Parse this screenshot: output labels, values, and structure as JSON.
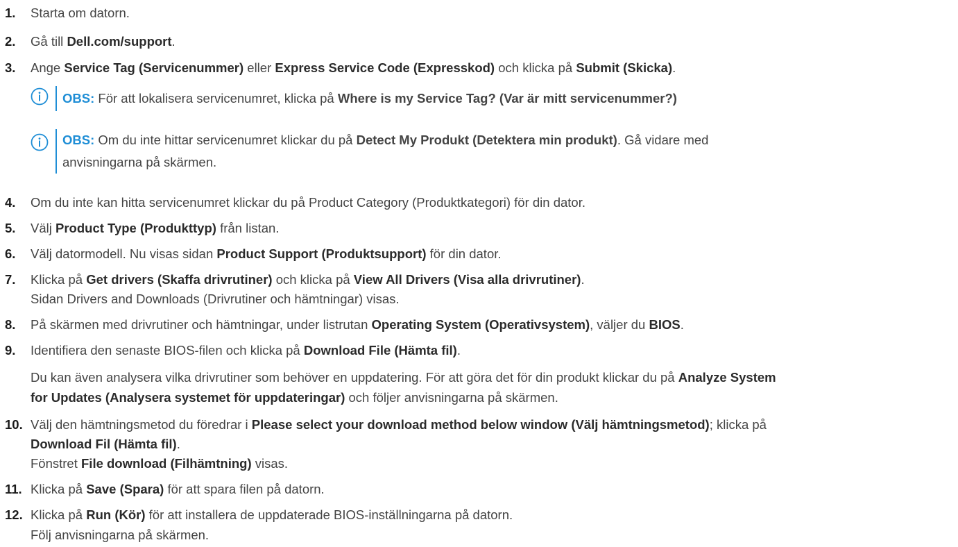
{
  "steps": [
    {
      "num": "1.",
      "parts": [
        {
          "t": "Starta om datorn."
        }
      ]
    },
    {
      "num": "2.",
      "parts": [
        {
          "t": "Gå till "
        },
        {
          "b": "Dell.com/support"
        },
        {
          "t": "."
        }
      ]
    },
    {
      "num": "3.",
      "parts": [
        {
          "t": "Ange "
        },
        {
          "b": "Service Tag (Servicenummer)"
        },
        {
          "t": " eller "
        },
        {
          "b": "Express Service Code (Expresskod)"
        },
        {
          "t": " och klicka på "
        },
        {
          "b": "Submit (Skicka)"
        },
        {
          "t": "."
        }
      ]
    },
    {
      "num": "4.",
      "parts": [
        {
          "t": "Om du inte kan hitta servicenumret klickar du på Product Category (Produktkategori) för din dator."
        }
      ]
    },
    {
      "num": "5.",
      "parts": [
        {
          "t": "Välj "
        },
        {
          "b": "Product Type (Produkttyp)"
        },
        {
          "t": " från listan."
        }
      ]
    },
    {
      "num": "6.",
      "parts": [
        {
          "t": "Välj datormodell. Nu visas sidan "
        },
        {
          "b": "Product Support (Produktsupport)"
        },
        {
          "t": " för din dator."
        }
      ]
    },
    {
      "num": "7.",
      "parts": [
        {
          "t": "Klicka på "
        },
        {
          "b": "Get drivers (Skaffa drivrutiner)"
        },
        {
          "t": " och klicka på "
        },
        {
          "b": "View All Drivers (Visa alla drivrutiner)"
        },
        {
          "t": "."
        }
      ]
    },
    {
      "num": "8.",
      "parts": [
        {
          "t": "På skärmen med drivrutiner och hämtningar, under listrutan "
        },
        {
          "b": "Operating System (Operativsystem)"
        },
        {
          "t": ", väljer du "
        },
        {
          "b": "BIOS"
        },
        {
          "t": "."
        }
      ]
    },
    {
      "num": "9.",
      "parts": [
        {
          "t": "Identifiera den senaste BIOS-filen och klicka på "
        },
        {
          "b": "Download File (Hämta fil)"
        },
        {
          "t": "."
        }
      ]
    },
    {
      "num": "10.",
      "parts": [
        {
          "t": "Välj den hämtningsmetod du föredrar i "
        },
        {
          "b": "Please select your download method below window (Välj hämtningsmetod)"
        },
        {
          "t": "; klicka på"
        }
      ]
    },
    {
      "num": "11.",
      "parts": [
        {
          "t": "Klicka på "
        },
        {
          "b": "Save (Spara)"
        },
        {
          "t": " för att spara filen på datorn."
        }
      ]
    },
    {
      "num": "12.",
      "parts": [
        {
          "t": "Klicka på "
        },
        {
          "b": "Run (Kör)"
        },
        {
          "t": " för att installera de uppdaterade BIOS-inställningarna på datorn."
        }
      ]
    }
  ],
  "continuations": [
    {
      "id": "step7-line2",
      "parts": [
        {
          "t": "Sidan Drivers and Downloads (Drivrutiner och hämtningar) visas."
        }
      ]
    },
    {
      "id": "step9-para-line1",
      "parts": [
        {
          "t": "Du kan även analysera vilka drivrutiner som behöver en uppdatering. För att göra det för din produkt klickar du på "
        },
        {
          "b": "Analyze System"
        }
      ]
    },
    {
      "id": "step9-para-line2",
      "parts": [
        {
          "b": "for Updates (Analysera systemet för uppdateringar)"
        },
        {
          "t": " och följer anvisningarna på skärmen."
        }
      ]
    },
    {
      "id": "step10-line2",
      "parts": [
        {
          "b": "Download Fil (Hämta fil)"
        },
        {
          "t": "."
        }
      ]
    },
    {
      "id": "step10-line3",
      "parts": [
        {
          "t": "Fönstret "
        },
        {
          "b": "File download (Filhämtning)"
        },
        {
          "t": " visas."
        }
      ]
    },
    {
      "id": "step12-line2",
      "parts": [
        {
          "t": "Följ anvisningarna på skärmen."
        }
      ]
    }
  ],
  "notes": [
    {
      "label": "OBS:",
      "parts": [
        {
          "t": " För att lokalisera servicenumret, klicka på "
        },
        {
          "b": "Where is my Service Tag? (Var är mitt servicenummer?)"
        }
      ]
    },
    {
      "label": "OBS:",
      "parts": [
        {
          "t": " Om du inte hittar servicenumret klickar du på "
        },
        {
          "b": "Detect My Produkt (Detektera min produkt)"
        },
        {
          "t": ". Gå vidare med"
        }
      ],
      "line2": "anvisningarna på skärmen."
    }
  ],
  "colors": {
    "accent": "#1f8ed6",
    "text": "#444444",
    "bold": "#2b2b2b"
  },
  "icons": {
    "note": "info-circle-icon"
  }
}
